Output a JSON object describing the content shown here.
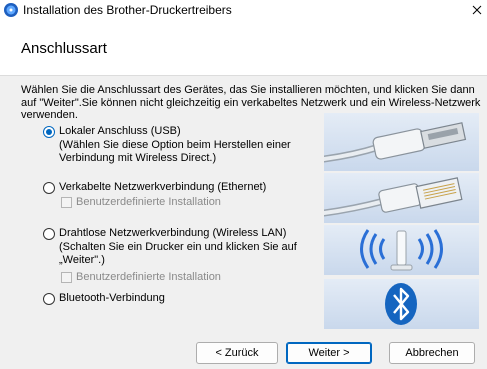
{
  "window": {
    "title": "Installation des Brother-Druckertreibers"
  },
  "header": {
    "title": "Anschlussart"
  },
  "intro": "Wählen Sie die Anschlussart des Gerätes, das Sie installieren möchten, und klicken Sie dann auf \"Weiter\".Sie können nicht gleichzeitig ein verkabeltes Netzwerk und ein Wireless-Netzwerk verwenden.",
  "options": [
    {
      "label": "Lokaler Anschluss (USB)",
      "desc1": "(Wählen Sie diese Option beim Herstellen einer",
      "desc2": "Verbindung mit Wireless Direct.)",
      "selected": true
    },
    {
      "label": "Verkabelte Netzwerkverbindung (Ethernet)",
      "checkbox": "Benutzerdefinierte Installation",
      "selected": false
    },
    {
      "label": "Drahtlose Netzwerkverbindung (Wireless LAN)",
      "desc1": "(Schalten Sie ein Drucker ein und klicken Sie auf",
      "desc2": "„Weiter\".)",
      "checkbox": "Benutzerdefinierte Installation",
      "selected": false
    },
    {
      "label": "Bluetooth-Verbindung",
      "selected": false
    }
  ],
  "icons": {
    "app": "brother-cd-icon",
    "close": "close-icon",
    "usb": "usb-cable-icon",
    "ethernet": "ethernet-cable-icon",
    "wireless": "wireless-router-icon",
    "bluetooth": "bluetooth-icon"
  },
  "colors": {
    "accent": "#0067c0",
    "bluetooth": "#1565c0",
    "panel": "#d4e0ef"
  },
  "buttons": {
    "back": "< Zurück",
    "next": "Weiter >",
    "cancel": "Abbrechen"
  }
}
